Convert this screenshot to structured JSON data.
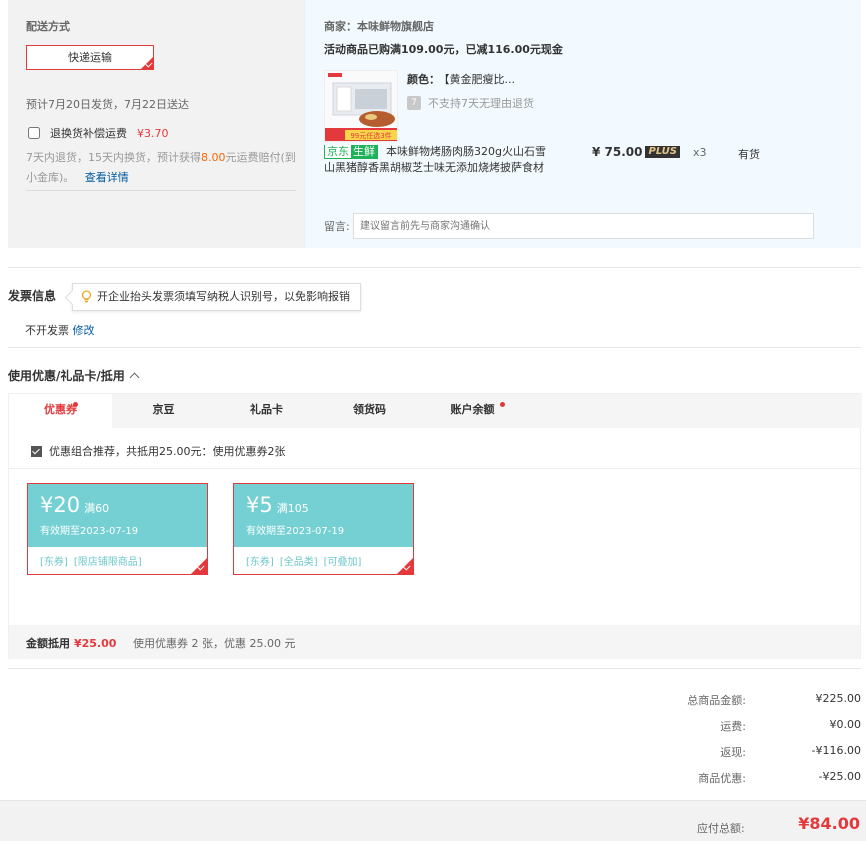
{
  "delivery": {
    "title": "配送方式",
    "method_label": "快递运输",
    "date_text": "预计7月20日发货，7月22日送达",
    "insurance_label": "退换货补偿运费",
    "insurance_price": "¥3.70",
    "insurance_desc_pre": "7天内退货，15天内换货，预计获得",
    "insurance_desc_amount": "8.00",
    "insurance_desc_post": "元运费赔付(到小金库)。",
    "details_link": "查看详情"
  },
  "shop": {
    "name": "商家：本味鲜物旗舰店",
    "promo": "活动商品已购满109.00元，已减116.00元现金",
    "product": {
      "color_label": "颜色：",
      "color_value": "【黄金肥瘦比...",
      "no_return": "不支持7天无理由退货",
      "fresh_tag_lead": "京东",
      "fresh_tag": "生鲜",
      "name": "本味鲜物烤肠肉肠320g火山石雪山黑猪醇香黑胡椒芝士味无添加烧烤披萨食材",
      "price": "¥ 75.00",
      "plus": "PLUS",
      "qty": "x3",
      "stock": "有货",
      "image_badge": "99元任选3件"
    },
    "message_label": "留言:",
    "message_placeholder": "建议留言前先与商家沟通确认"
  },
  "invoice": {
    "title": "发票信息",
    "tip": "开企业抬头发票须填写纳税人识别号，以免影响报销",
    "status": "不开发票",
    "edit_link": "修改"
  },
  "coupons": {
    "title": "使用优惠/礼品卡/抵用",
    "tabs": [
      {
        "label": "优惠券"
      },
      {
        "label": "京豆"
      },
      {
        "label": "礼品卡"
      },
      {
        "label": "领货码"
      },
      {
        "label": "账户余额"
      }
    ],
    "combo_text": "优惠组合推荐，共抵用25.00元：使用优惠券2张",
    "items": [
      {
        "amount": "¥20",
        "condition": "满60",
        "expiry": "有效期至2023-07-19",
        "tags": [
          "[东券]",
          "[限店铺限商品]"
        ]
      },
      {
        "amount": "¥5",
        "condition": "满105",
        "expiry": "有效期至2023-07-19",
        "tags": [
          "[东券]",
          "[全品类]",
          "[可叠加]"
        ]
      }
    ],
    "footer_label": "金额抵用",
    "footer_amount": "¥25.00",
    "footer_desc": "使用优惠券 2 张，优惠 25.00 元"
  },
  "summary": {
    "rows": [
      {
        "label": "总商品金额:",
        "value": "¥225.00"
      },
      {
        "label": "运费:",
        "value": "¥0.00"
      },
      {
        "label": "返现:",
        "value": "-¥116.00"
      },
      {
        "label": "商品优惠:",
        "value": "-¥25.00"
      }
    ],
    "pay_label": "应付总额:",
    "pay_amount": "¥84.00"
  },
  "colors": {
    "accent": "#e4393c",
    "coupon_teal": "#75d0d3",
    "link": "#005aa0",
    "fresh_green": "#1fb25a"
  }
}
